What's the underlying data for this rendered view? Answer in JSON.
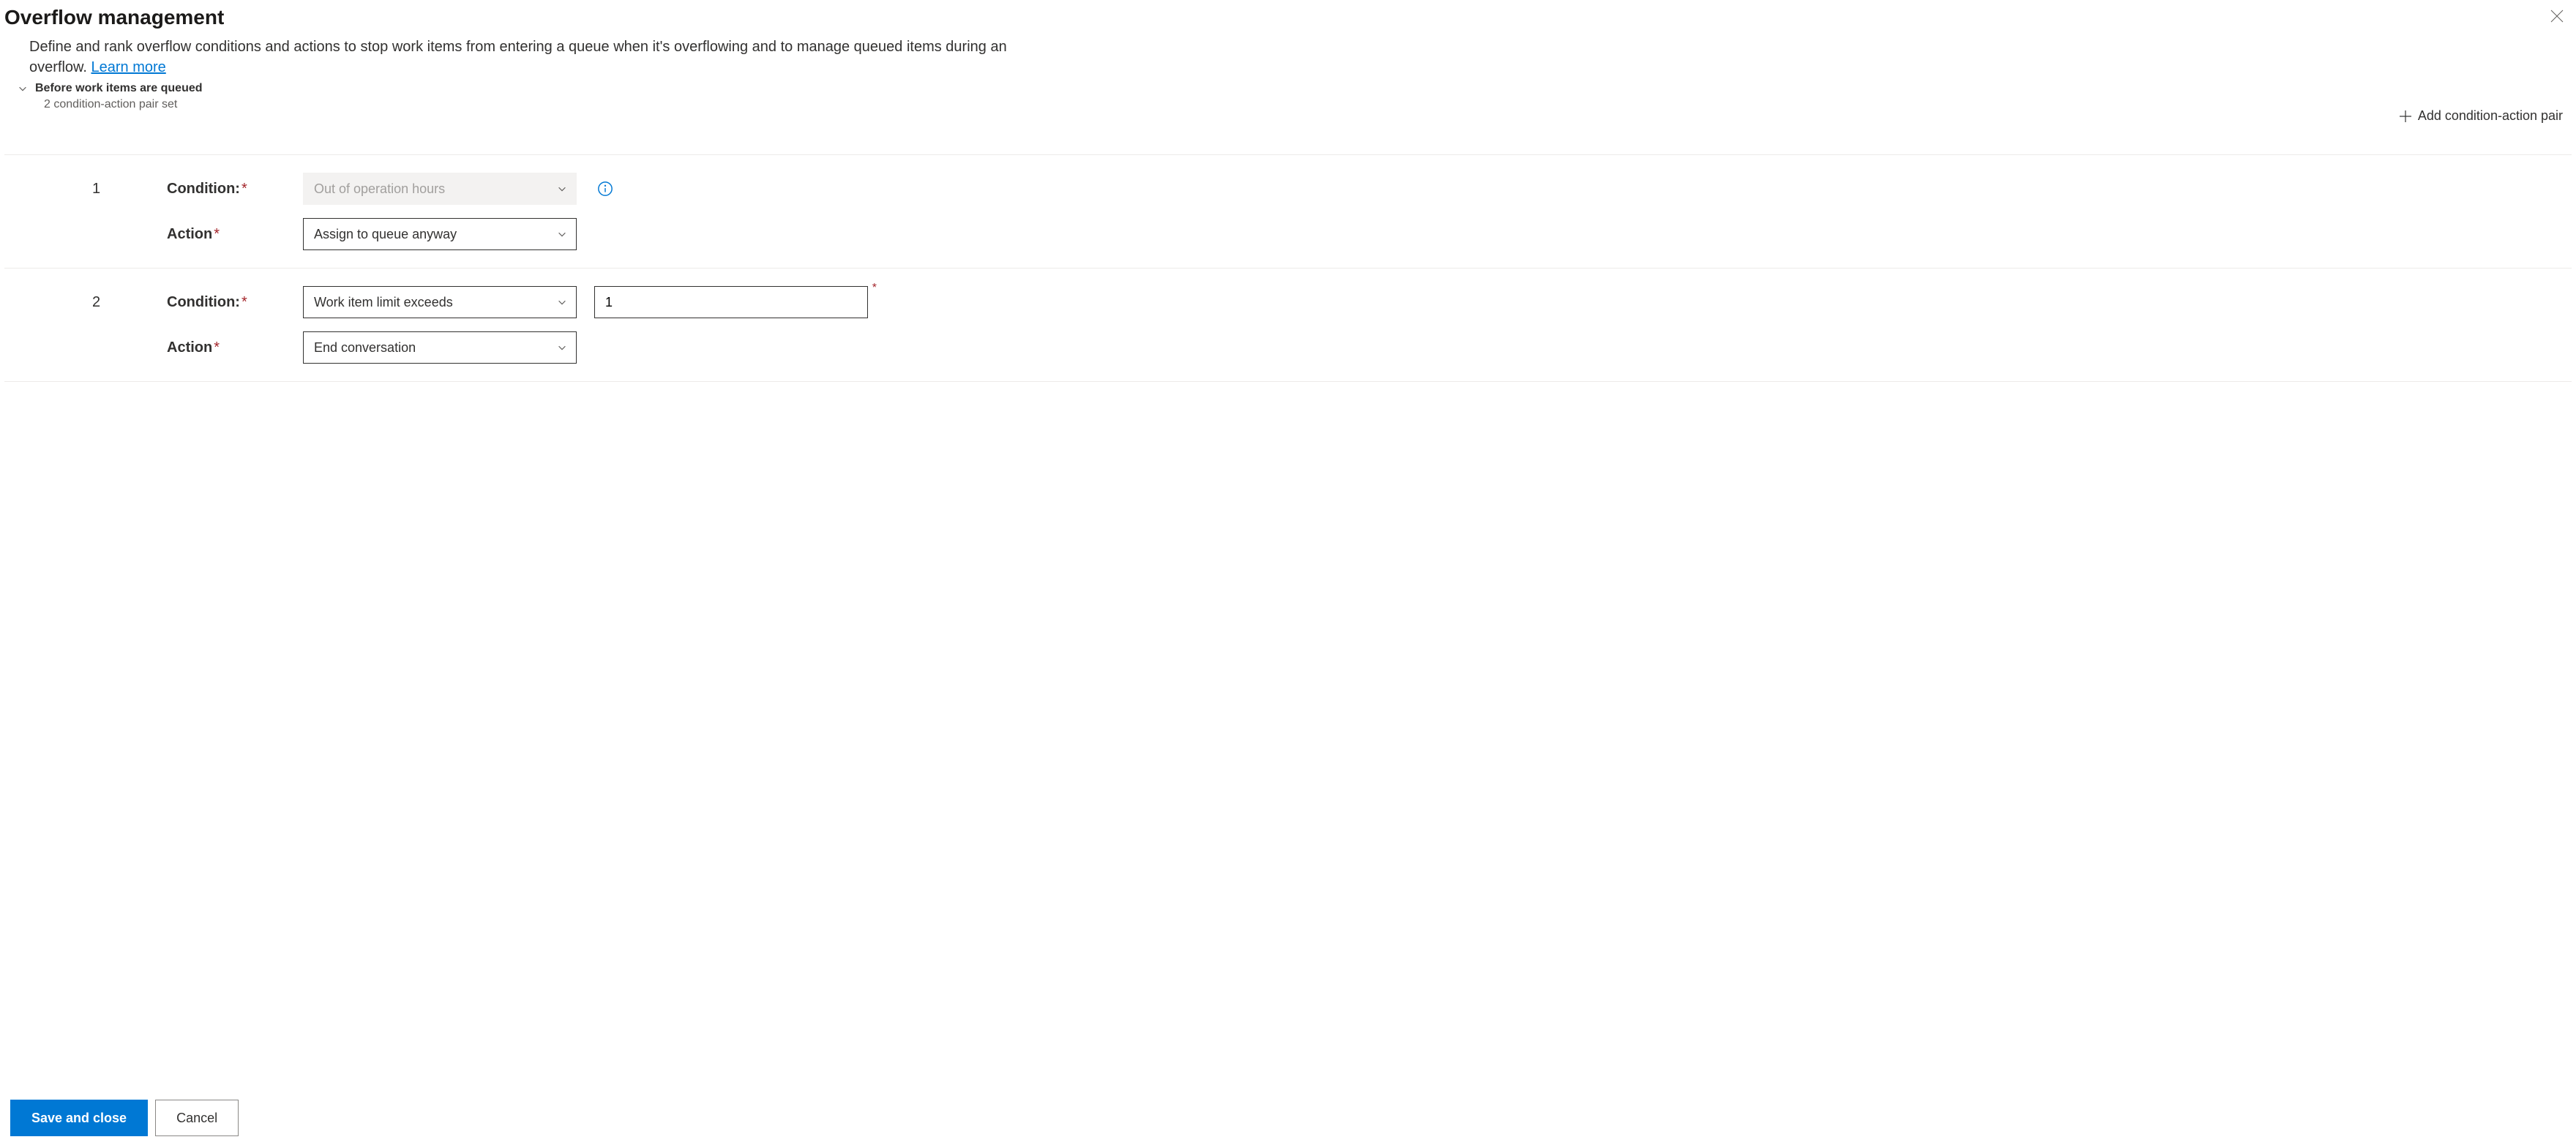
{
  "header": {
    "title": "Overflow management",
    "description_pre": "Define and rank overflow conditions and actions to stop work items from entering a queue when it's overflowing and to manage queued items during an overflow. ",
    "learn_more": "Learn more"
  },
  "section": {
    "title": "Before work items are queued",
    "subtitle": "2 condition-action pair set",
    "add_label": "Add condition-action pair"
  },
  "labels": {
    "condition": "Condition:",
    "action": "Action"
  },
  "pairs": [
    {
      "idx": "1",
      "condition": "Out of operation hours",
      "condition_disabled": true,
      "has_info": true,
      "action": "Assign to queue anyway",
      "extra_input": null
    },
    {
      "idx": "2",
      "condition": "Work item limit exceeds",
      "condition_disabled": false,
      "has_info": false,
      "action": "End conversation",
      "extra_input": "1"
    }
  ],
  "footer": {
    "save": "Save and close",
    "cancel": "Cancel"
  }
}
